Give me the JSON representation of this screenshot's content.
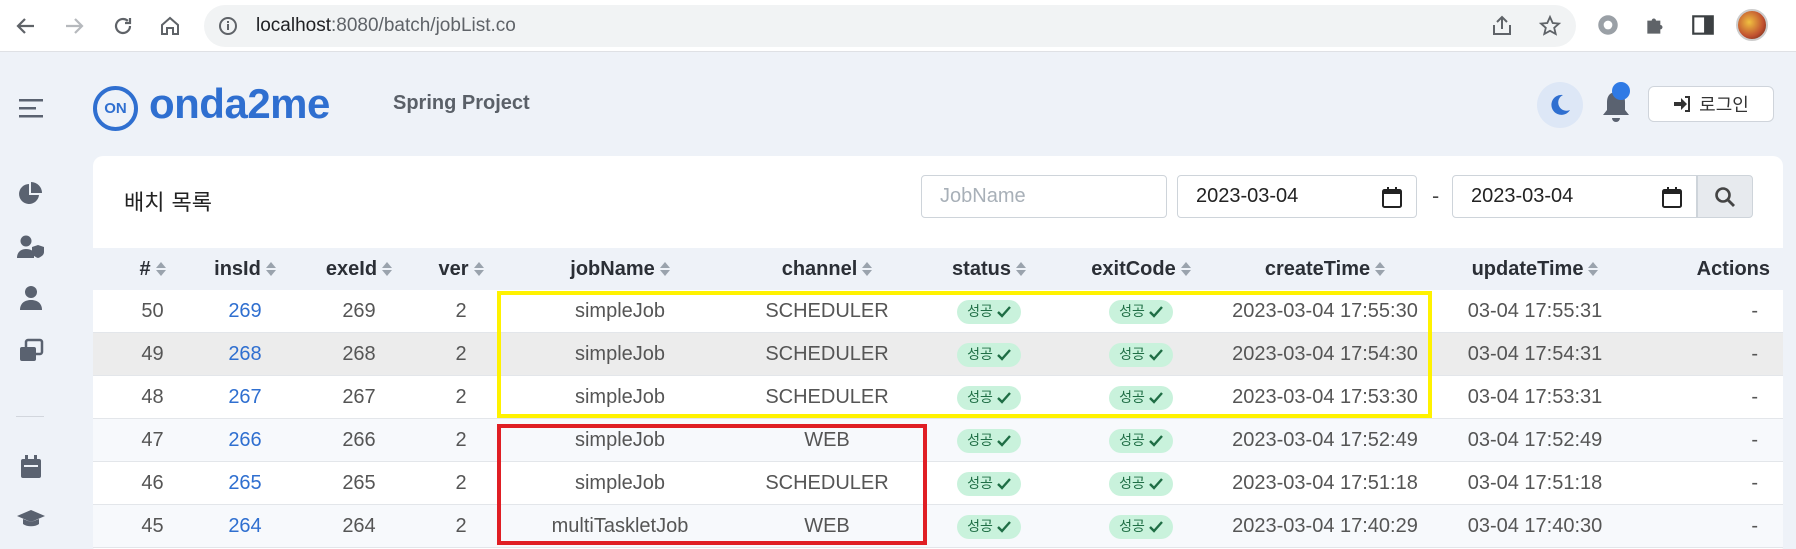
{
  "browser": {
    "url_host": "localhost",
    "url_rest": ":8080/batch/jobList.co"
  },
  "header": {
    "logo_mark": "ON",
    "logo_text": "onda2me",
    "project": "Spring Project",
    "login_label": "로그인"
  },
  "card": {
    "title": "배치 목록",
    "search_placeholder": "JobName",
    "date_from": "2023-03-04",
    "date_to": "2023-03-04",
    "date_sep": "-"
  },
  "table": {
    "columns": [
      "#",
      "insId",
      "exeId",
      "ver",
      "jobName",
      "channel",
      "status",
      "exitCode",
      "createTime",
      "updateTime",
      "Actions"
    ],
    "rows": [
      {
        "no": "50",
        "insId": "269",
        "exeId": "269",
        "ver": "2",
        "jobName": "simpleJob",
        "channel": "SCHEDULER",
        "status": "성공",
        "exitCode": "성공",
        "createTime": "2023-03-04 17:55:30",
        "updateTime": "03-04 17:55:31",
        "actions": "-"
      },
      {
        "no": "49",
        "insId": "268",
        "exeId": "268",
        "ver": "2",
        "jobName": "simpleJob",
        "channel": "SCHEDULER",
        "status": "성공",
        "exitCode": "성공",
        "createTime": "2023-03-04 17:54:30",
        "updateTime": "03-04 17:54:31",
        "actions": "-"
      },
      {
        "no": "48",
        "insId": "267",
        "exeId": "267",
        "ver": "2",
        "jobName": "simpleJob",
        "channel": "SCHEDULER",
        "status": "성공",
        "exitCode": "성공",
        "createTime": "2023-03-04 17:53:30",
        "updateTime": "03-04 17:53:31",
        "actions": "-"
      },
      {
        "no": "47",
        "insId": "266",
        "exeId": "266",
        "ver": "2",
        "jobName": "simpleJob",
        "channel": "WEB",
        "status": "성공",
        "exitCode": "성공",
        "createTime": "2023-03-04 17:52:49",
        "updateTime": "03-04 17:52:49",
        "actions": "-"
      },
      {
        "no": "46",
        "insId": "265",
        "exeId": "265",
        "ver": "2",
        "jobName": "simpleJob",
        "channel": "SCHEDULER",
        "status": "성공",
        "exitCode": "성공",
        "createTime": "2023-03-04 17:51:18",
        "updateTime": "03-04 17:51:18",
        "actions": "-"
      },
      {
        "no": "45",
        "insId": "264",
        "exeId": "264",
        "ver": "2",
        "jobName": "multiTaskletJob",
        "channel": "WEB",
        "status": "성공",
        "exitCode": "성공",
        "createTime": "2023-03-04 17:40:29",
        "updateTime": "03-04 17:40:30",
        "actions": "-"
      }
    ]
  },
  "icons": {
    "back": "arrow-left-icon",
    "forward": "arrow-right-icon",
    "reload": "reload-icon",
    "home": "home-icon",
    "menu": "hamburger-menu-icon",
    "theme": "moon-icon",
    "notify": "bell-icon",
    "search": "search-icon"
  },
  "colors": {
    "brand": "#2f6fd0",
    "badge_bg": "#c9f2dc",
    "badge_text": "#1f6e45",
    "highlight_yellow": "#fff200",
    "highlight_red": "#e01e24"
  }
}
